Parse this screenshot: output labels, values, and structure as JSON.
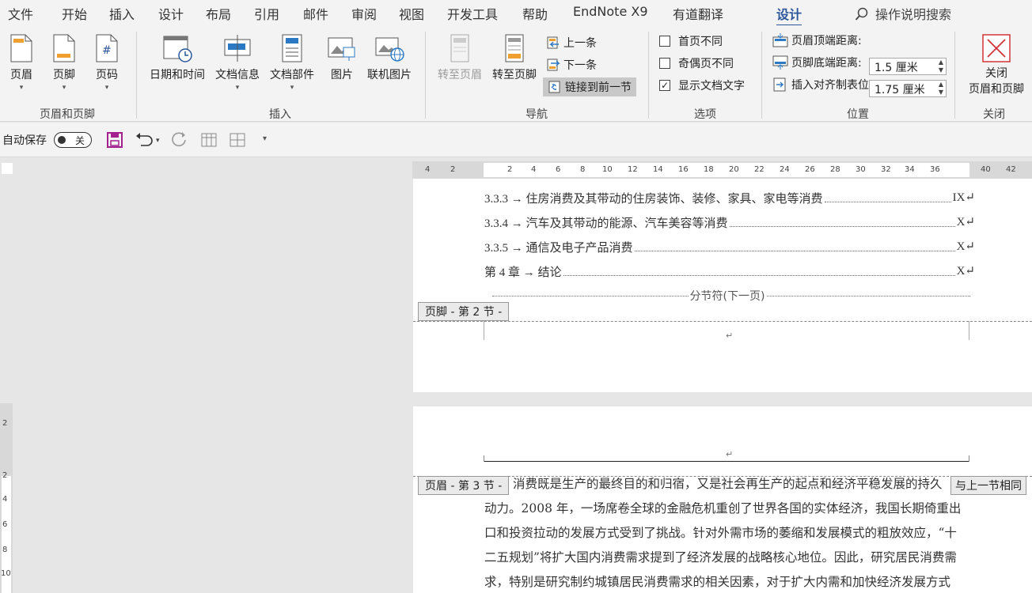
{
  "menu": {
    "tabs": [
      "文件",
      "开始",
      "插入",
      "设计",
      "布局",
      "引用",
      "邮件",
      "审阅",
      "视图",
      "开发工具",
      "帮助",
      "EndNote X9",
      "有道翻译"
    ],
    "active_tab": "设计",
    "search_label": "操作说明搜索"
  },
  "ribbon": {
    "header_footer": {
      "group": "页眉和页脚",
      "header": "页眉",
      "footer": "页脚",
      "page_number": "页码"
    },
    "insert": {
      "group": "插入",
      "date_time": "日期和时间",
      "doc_info": "文档信息",
      "doc_parts": "文档部件",
      "picture": "图片",
      "online_picture": "联机图片"
    },
    "navigation": {
      "group": "导航",
      "goto_header": "转至页眉",
      "goto_footer": "转至页脚",
      "previous": "上一条",
      "next": "下一条",
      "link_previous": "链接到前一节"
    },
    "options": {
      "group": "选项",
      "different_first": "首页不同",
      "different_odd_even": "奇偶页不同",
      "show_doc_text": "显示文档文字",
      "show_doc_text_checked": "✓"
    },
    "position": {
      "group": "位置",
      "header_top_label": "页眉顶端距离:",
      "header_top_value": "1.5 厘米",
      "footer_bottom_label": "页脚底端距离:",
      "footer_bottom_value": "1.75 厘米",
      "align_tab": "插入对齐制表位"
    },
    "close": {
      "group": "关闭",
      "label_line1": "关闭",
      "label_line2": "页眉和页脚"
    }
  },
  "qat": {
    "autosave": "自动保存",
    "autosave_state": "关"
  },
  "ruler": {
    "ticks": [
      "4",
      "2",
      "2",
      "4",
      "6",
      "8",
      "10",
      "12",
      "14",
      "16",
      "18",
      "20",
      "22",
      "24",
      "26",
      "28",
      "30",
      "32",
      "34",
      "36",
      "40",
      "42"
    ],
    "vticks": [
      "2",
      "2",
      "4",
      "6",
      "8",
      "10"
    ]
  },
  "document": {
    "toc": [
      {
        "text": "3.3.3 → 住房消费及其带动的住房装饰、装修、家具、家电等消费",
        "page": "IX↵"
      },
      {
        "text": "3.3.4 → 汽车及其带动的能源、汽车美容等消费",
        "page": "X↵"
      },
      {
        "text": "3.3.5 → 通信及电子产品消费",
        "page": "X↵"
      },
      {
        "text": "第 4 章 → 结论",
        "page": "X↵"
      }
    ],
    "section_break": "分节符(下一页)",
    "footer_tag": "页脚 - 第 2 节 -",
    "header_tag": "页眉 - 第 3 节 -",
    "same_as_previous": "与上一节相同",
    "para_mark": "↵",
    "body_lines": [
      "消费既是生产的最终目的和归宿，又是社会再生产的起点和经济平稳发展的持久",
      "动力。2008 年，一场席卷全球的金融危机重创了世界各国的实体经济，我国长期倚重出",
      "口和投资拉动的发展方式受到了挑战。针对外需市场的萎缩和发展模式的粗放效应，“十",
      "二五规划”将扩大国内消费需求提到了经济发展的战略核心地位。因此，研究居民消费需",
      "求，特别是研究制约城镇居民消费需求的相关因素，对于扩大内需和加快经济发展方式"
    ]
  },
  "colors": {
    "accent": "#2b579a",
    "close_red": "#d13438",
    "save_purple": "#a4208f"
  }
}
